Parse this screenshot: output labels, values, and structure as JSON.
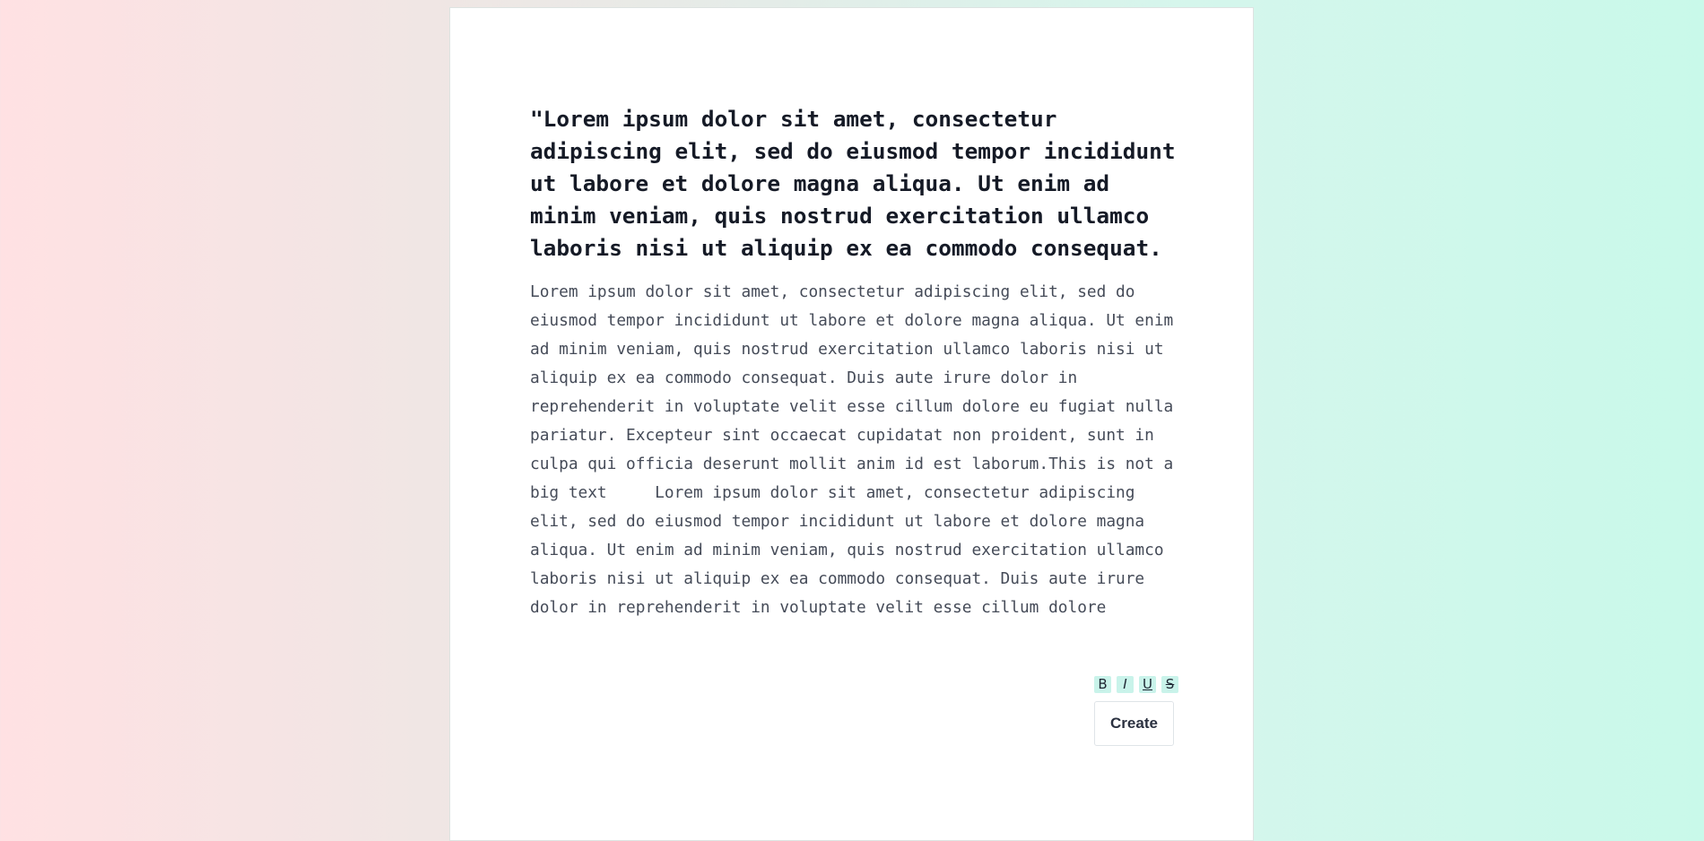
{
  "editor": {
    "heading": "\"Lorem ipsum dolor sit amet, consectetur adipiscing elit, sed do eiusmod tempor incididunt ut labore et dolore magna aliqua. Ut enim ad minim veniam, quis nostrud exercitation ullamco laboris nisi ut aliquip ex ea commodo consequat.",
    "body": "Lorem ipsum dolor sit amet, consectetur adipiscing elit, sed do eiusmod tempor incididunt ut labore et dolore magna aliqua. Ut enim ad minim veniam, quis nostrud exercitation ullamco laboris nisi ut aliquip ex ea commodo consequat. Duis aute irure dolor in reprehenderit in voluptate velit esse cillum dolore eu fugiat nulla pariatur. Excepteur sint occaecat cupidatat non proident, sunt in culpa qui officia deserunt mollit anim id est laborum.This is not a big text     Lorem ipsum dolor sit amet, consectetur adipiscing elit, sed do eiusmod tempor incididunt ut labore et dolore magna aliqua. Ut enim ad minim veniam, quis nostrud exercitation ullamco laboris nisi ut aliquip ex ea commodo consequat. Duis aute irure dolor in reprehenderit in voluptate velit esse cillum dolore"
  },
  "toolbar": {
    "bold_label": "B",
    "italic_label": "I",
    "underline_label": "U",
    "strike_label": "S",
    "create_label": "Create"
  },
  "colors": {
    "toolbar_button_bg": "#c9f3ea",
    "heading_text": "#151a26",
    "body_text": "#454b58",
    "background_left": "#ffe1e3",
    "background_right": "#c9f9ea"
  }
}
